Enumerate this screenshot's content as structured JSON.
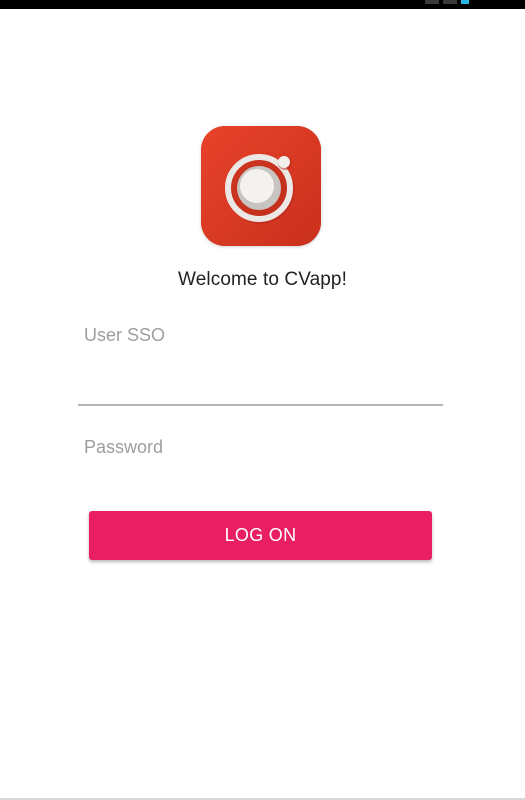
{
  "status_bar": {
    "icons": [
      "signal-icon",
      "wifi-icon",
      "battery-icon"
    ]
  },
  "logo": {
    "icon": "ionic-logo-icon",
    "background_color": "#e03a24"
  },
  "login": {
    "welcome_text": "Welcome to CVapp!",
    "user_sso": {
      "placeholder": "User SSO",
      "value": ""
    },
    "password": {
      "placeholder": "Password",
      "value": ""
    },
    "logon_label": "LOG ON",
    "button_color": "#e91e63"
  }
}
